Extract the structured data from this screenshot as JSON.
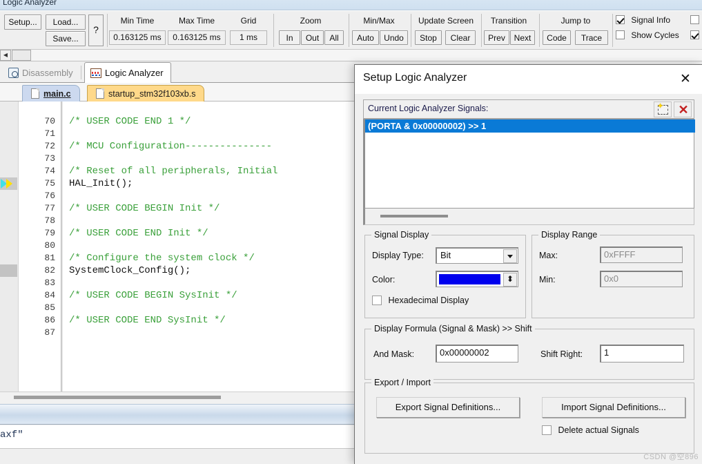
{
  "logic_analyzer_window": {
    "title": "Logic Analyzer",
    "toolbar": {
      "setup_button": "Setup...",
      "load_button": "Load...",
      "save_button": "Save...",
      "help_button": "?",
      "min_time": {
        "label": "Min Time",
        "value": "0.163125 ms"
      },
      "max_time": {
        "label": "Max Time",
        "value": "0.163125 ms"
      },
      "grid": {
        "label": "Grid",
        "value": "1 ms"
      },
      "zoom": {
        "label": "Zoom",
        "in": "In",
        "out": "Out",
        "all": "All"
      },
      "min_max": {
        "label": "Min/Max",
        "auto": "Auto",
        "undo": "Undo"
      },
      "update_screen": {
        "label": "Update Screen",
        "stop": "Stop",
        "clear": "Clear"
      },
      "transition": {
        "label": "Transition",
        "prev": "Prev",
        "next": "Next"
      },
      "jump_to": {
        "label": "Jump to",
        "code": "Code",
        "trace": "Trace"
      },
      "checkboxes": [
        {
          "label": "Signal Info",
          "checked": true
        },
        {
          "label": "Show Cycles",
          "checked": false
        },
        {
          "label": "",
          "checked": false
        },
        {
          "label": "",
          "checked": true
        }
      ]
    }
  },
  "view_tabs": [
    {
      "label": "Disassembly",
      "icon": "disassembly-icon",
      "active": false
    },
    {
      "label": "Logic Analyzer",
      "icon": "logic-analyzer-icon",
      "active": true
    }
  ],
  "file_tabs": [
    {
      "label": "main.c",
      "selected": true
    },
    {
      "label": "startup_stm32f103xb.s",
      "selected": false
    }
  ],
  "editor": {
    "lines": [
      {
        "num": "70",
        "text": "/* USER CODE END 1 */",
        "type": "comment"
      },
      {
        "num": "71",
        "text": "",
        "type": "code"
      },
      {
        "num": "72",
        "text": "/* MCU Configuration---------------",
        "type": "comment"
      },
      {
        "num": "73",
        "text": "",
        "type": "code"
      },
      {
        "num": "74",
        "text": "/* Reset of all peripherals, Initial",
        "type": "comment"
      },
      {
        "num": "75",
        "text": "HAL_Init();",
        "type": "code"
      },
      {
        "num": "76",
        "text": "",
        "type": "code"
      },
      {
        "num": "77",
        "text": "/* USER CODE BEGIN Init */",
        "type": "comment"
      },
      {
        "num": "78",
        "text": "",
        "type": "code"
      },
      {
        "num": "79",
        "text": "/* USER CODE END Init */",
        "type": "comment"
      },
      {
        "num": "80",
        "text": "",
        "type": "code"
      },
      {
        "num": "81",
        "text": "/* Configure the system clock */",
        "type": "comment"
      },
      {
        "num": "82",
        "text": "SystemClock_Config();",
        "type": "code"
      },
      {
        "num": "83",
        "text": "",
        "type": "code"
      },
      {
        "num": "84",
        "text": "/* USER CODE BEGIN SysInit */",
        "type": "comment"
      },
      {
        "num": "85",
        "text": "",
        "type": "code"
      },
      {
        "num": "86",
        "text": "/* USER CODE END SysInit */",
        "type": "comment"
      },
      {
        "num": "87",
        "text": "",
        "type": "code"
      }
    ],
    "pc_marker_line": "75",
    "bookmark_line": "82"
  },
  "command_window": {
    "text": "axf\""
  },
  "dialog": {
    "title": "Setup Logic Analyzer",
    "close_label": "✕",
    "signals_section": {
      "header_label": "Current Logic Analyzer Signals:",
      "new_icon": "new-signal-icon",
      "delete_icon": "delete-signal-icon",
      "items": [
        {
          "text": "(PORTA & 0x00000002) >> 1",
          "selected": true
        }
      ]
    },
    "signal_display": {
      "legend": "Signal Display",
      "display_type_label": "Display Type:",
      "display_type_value": "Bit",
      "color_label": "Color:",
      "color_value": "#0000ee",
      "hexadecimal_label": "Hexadecimal Display",
      "hexadecimal_checked": false
    },
    "display_range": {
      "legend": "Display Range",
      "max_label": "Max:",
      "max_value": "0xFFFF",
      "min_label": "Min:",
      "min_value": "0x0"
    },
    "display_formula": {
      "legend": "Display Formula (Signal & Mask) >> Shift",
      "and_mask_label": "And Mask:",
      "and_mask_value": "0x00000002",
      "shift_right_label": "Shift Right:",
      "shift_right_value": "1"
    },
    "export_import": {
      "legend": "Export / Import",
      "export_button": "Export Signal Definitions...",
      "import_button": "Import Signal Definitions...",
      "delete_actual_label": "Delete actual Signals",
      "delete_actual_checked": false
    }
  },
  "watermark": "CSDN @空896"
}
